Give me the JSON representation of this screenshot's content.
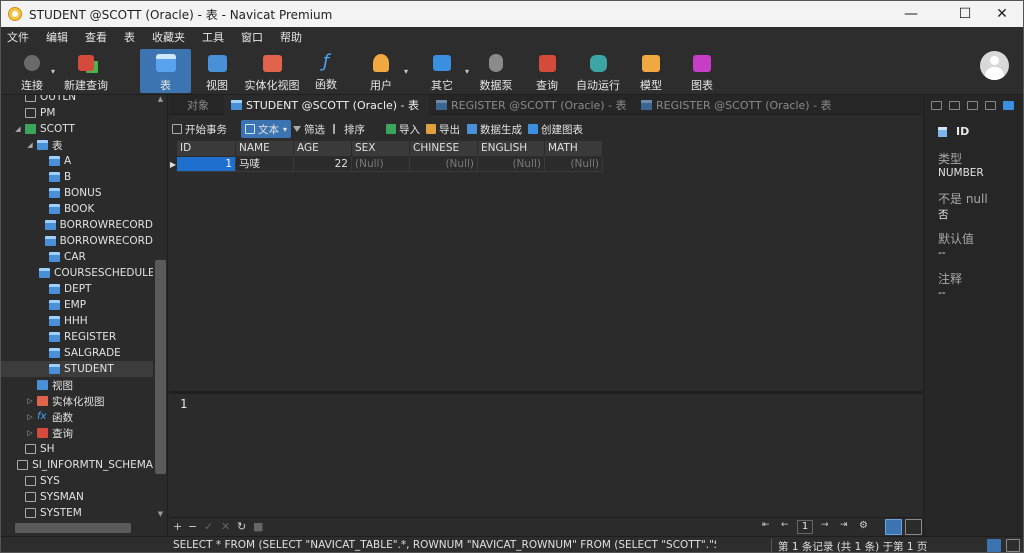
{
  "window": {
    "title": "STUDENT @SCOTT (Oracle) - 表 - Navicat Premium",
    "controls": {
      "minimize": "—",
      "maximize": "☐",
      "close": "✕"
    }
  },
  "menu": [
    "文件",
    "编辑",
    "查看",
    "表",
    "收藏夹",
    "工具",
    "窗口",
    "帮助"
  ],
  "toolbar": {
    "connect": "连接",
    "new_query": "新建查询",
    "table": "表",
    "view": "视图",
    "materialized_view": "实体化视图",
    "function": "函数",
    "user": "用户",
    "others": "其它",
    "data_pump": "数据泵",
    "query": "查询",
    "automation": "自动运行",
    "model": "模型",
    "chart": "图表"
  },
  "sidebar": {
    "items": [
      {
        "label": "OUTLN",
        "icon": "schema",
        "indent": 2,
        "twisty": ""
      },
      {
        "label": "PM",
        "icon": "schema",
        "indent": 2,
        "twisty": ""
      },
      {
        "label": "SCOTT",
        "icon": "schema-green",
        "indent": 2,
        "twisty": "◢"
      },
      {
        "label": "表",
        "icon": "table",
        "indent": 3,
        "twisty": "◢"
      },
      {
        "label": "A",
        "icon": "table",
        "indent": 4,
        "twisty": ""
      },
      {
        "label": "B",
        "icon": "table",
        "indent": 4,
        "twisty": ""
      },
      {
        "label": "BONUS",
        "icon": "table",
        "indent": 4,
        "twisty": ""
      },
      {
        "label": "BOOK",
        "icon": "table",
        "indent": 4,
        "twisty": ""
      },
      {
        "label": "BORROWRECORD",
        "icon": "table",
        "indent": 4,
        "twisty": ""
      },
      {
        "label": "BORROWRECORD",
        "icon": "table",
        "indent": 4,
        "twisty": ""
      },
      {
        "label": "CAR",
        "icon": "table",
        "indent": 4,
        "twisty": ""
      },
      {
        "label": "COURSESCHEDULE",
        "icon": "table",
        "indent": 4,
        "twisty": ""
      },
      {
        "label": "DEPT",
        "icon": "table",
        "indent": 4,
        "twisty": ""
      },
      {
        "label": "EMP",
        "icon": "table",
        "indent": 4,
        "twisty": ""
      },
      {
        "label": "HHH",
        "icon": "table",
        "indent": 4,
        "twisty": ""
      },
      {
        "label": "REGISTER",
        "icon": "table",
        "indent": 4,
        "twisty": ""
      },
      {
        "label": "SALGRADE",
        "icon": "table",
        "indent": 4,
        "twisty": ""
      },
      {
        "label": "STUDENT",
        "icon": "table",
        "indent": 4,
        "twisty": "",
        "selected": true
      },
      {
        "label": "视图",
        "icon": "view",
        "indent": 3,
        "twisty": ""
      },
      {
        "label": "实体化视图",
        "icon": "mview",
        "indent": 3,
        "twisty": "▷"
      },
      {
        "label": "函数",
        "icon": "func",
        "indent": 3,
        "twisty": "▷"
      },
      {
        "label": "查询",
        "icon": "query",
        "indent": 3,
        "twisty": "▷"
      },
      {
        "label": "SH",
        "icon": "schema",
        "indent": 2,
        "twisty": ""
      },
      {
        "label": "SI_INFORMTN_SCHEMA",
        "icon": "schema",
        "indent": 2,
        "twisty": ""
      },
      {
        "label": "SYS",
        "icon": "schema",
        "indent": 2,
        "twisty": ""
      },
      {
        "label": "SYSMAN",
        "icon": "schema",
        "indent": 2,
        "twisty": ""
      },
      {
        "label": "SYSTEM",
        "icon": "schema",
        "indent": 2,
        "twisty": ""
      }
    ]
  },
  "tabs": {
    "objects": "对象",
    "t1": "STUDENT @SCOTT (Oracle) - 表",
    "t2": "REGISTER @SCOTT (Oracle) - 表",
    "t3": "REGISTER @SCOTT (Oracle) - 表"
  },
  "objbar": {
    "begin_tx": "开始事务",
    "text": "文本",
    "filter": "筛选",
    "sort": "排序",
    "import": "导入",
    "export": "导出",
    "data_gen": "数据生成",
    "create_chart": "创建图表"
  },
  "grid": {
    "columns": [
      "ID",
      "NAME",
      "AGE",
      "SEX",
      "CHINESE",
      "ENGLISH",
      "MATH"
    ],
    "rows": [
      [
        "1",
        "马唛",
        "22",
        "(Null)",
        "(Null)",
        "(Null)",
        "(Null)"
      ]
    ]
  },
  "editor": {
    "line1": "1"
  },
  "navbar": {
    "page": "1"
  },
  "rpanel": {
    "field_name": "ID",
    "type_label": "类型",
    "type_value": "NUMBER",
    "notnull_label": "不是 null",
    "notnull_value": "否",
    "default_label": "默认值",
    "default_value": "--",
    "comment_label": "注释",
    "comment_value": "--"
  },
  "status": {
    "sql": "SELECT * FROM (SELECT \"NAVICAT_TABLE\".*, ROWNUM \"NAVICAT_ROWNUM\" FROM (SELECT \"SCOTT\".\"STUDEN",
    "records": "第 1 条记录 (共 1 条) 于第 1 页"
  }
}
